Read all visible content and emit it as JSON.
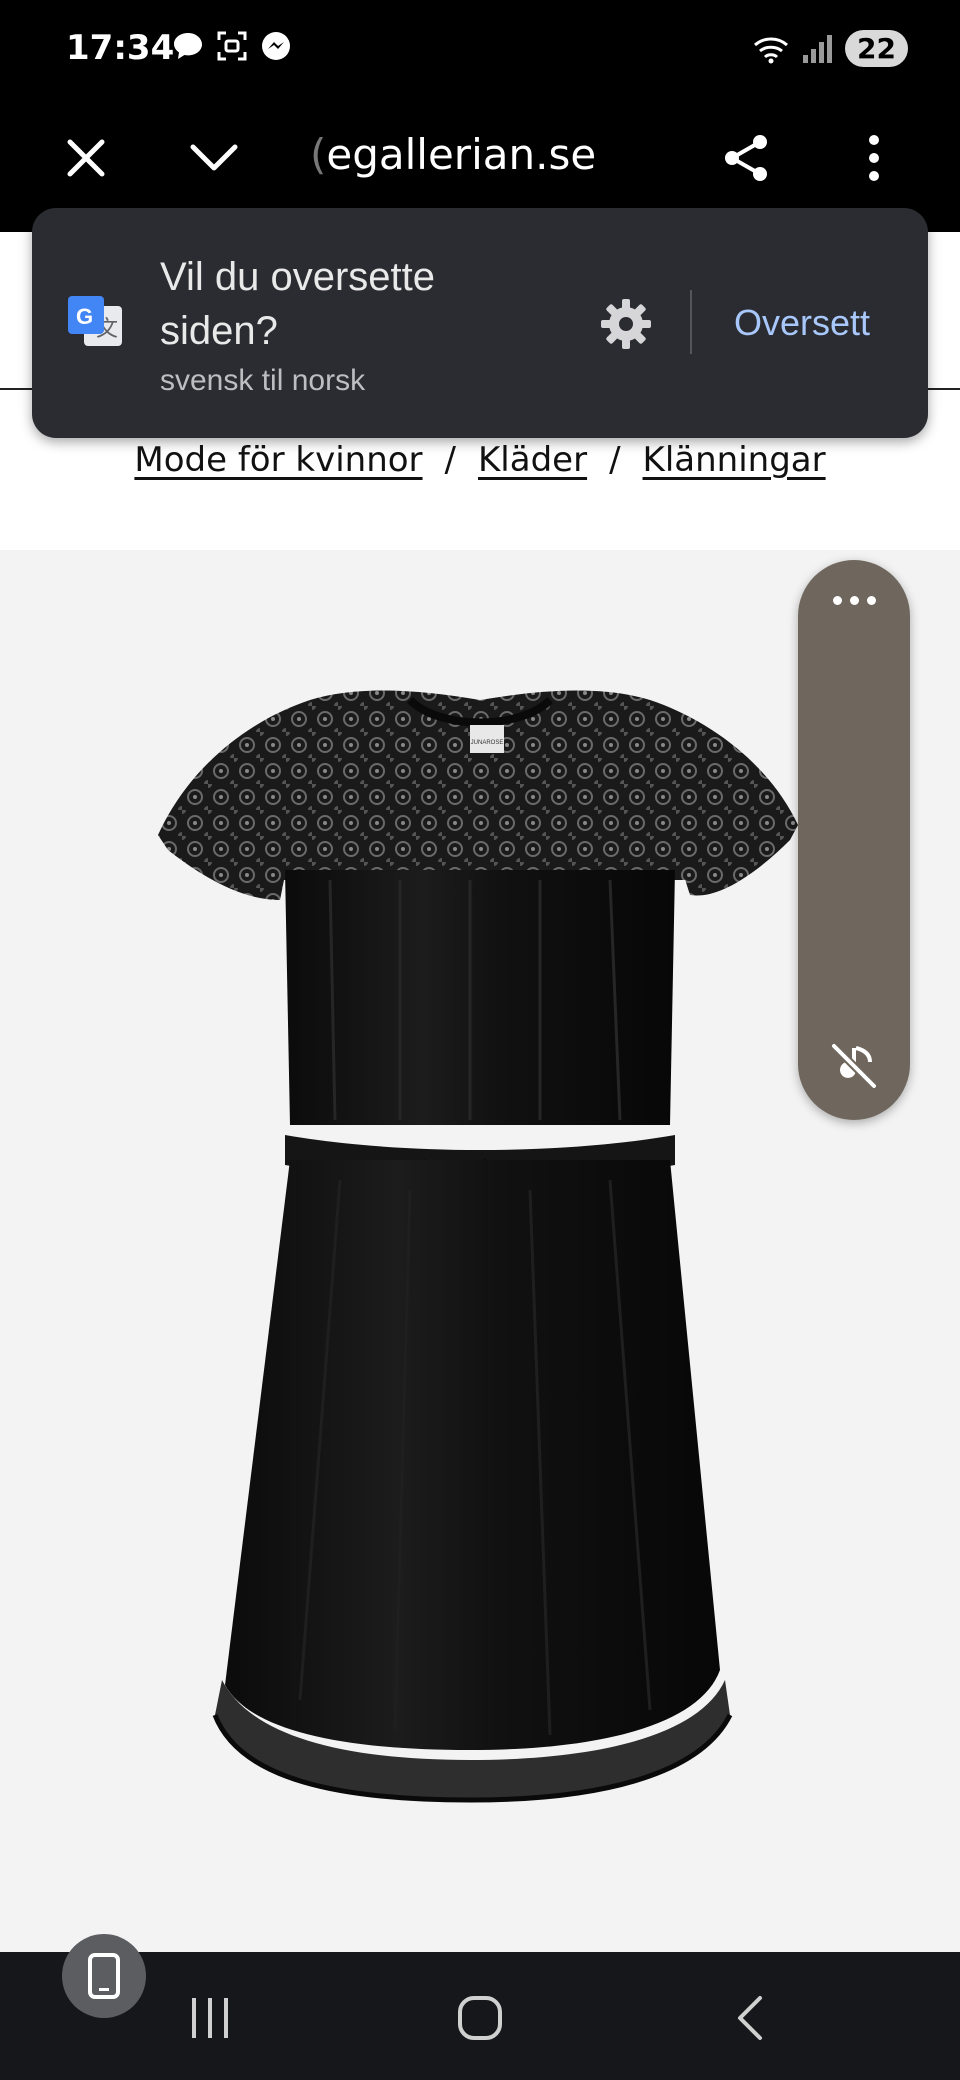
{
  "status_bar": {
    "time": "17:34",
    "battery": "22",
    "icons_left": [
      "chat-bubble-icon",
      "scan-icon",
      "messenger-icon"
    ],
    "icons_right": [
      "wifi-icon",
      "signal-icon"
    ]
  },
  "toolbar": {
    "url_prefix": "(",
    "url": "egallerian.se",
    "icons": [
      "close-icon",
      "chevron-down-icon",
      "share-icon",
      "more-vert-icon"
    ]
  },
  "translate_prompt": {
    "title": "Vil du oversette siden?",
    "subtitle": "svensk til norsk",
    "action": "Oversett",
    "accent": "#a8c7fa"
  },
  "breadcrumb": {
    "items": [
      "Mode för kvinnor",
      "Kläder",
      "Klänningar"
    ],
    "separator": "/"
  },
  "product": {
    "image_desc_icon": "black-dress-image",
    "brand_tag": "JUNAROSE"
  },
  "float_panel": {
    "icons": [
      "more-horiz-icon",
      "mute-icon"
    ],
    "color": "#6f675d"
  },
  "nav_bar": {
    "icons": [
      "recents-icon",
      "home-icon",
      "back-icon",
      "phone-icon"
    ]
  }
}
